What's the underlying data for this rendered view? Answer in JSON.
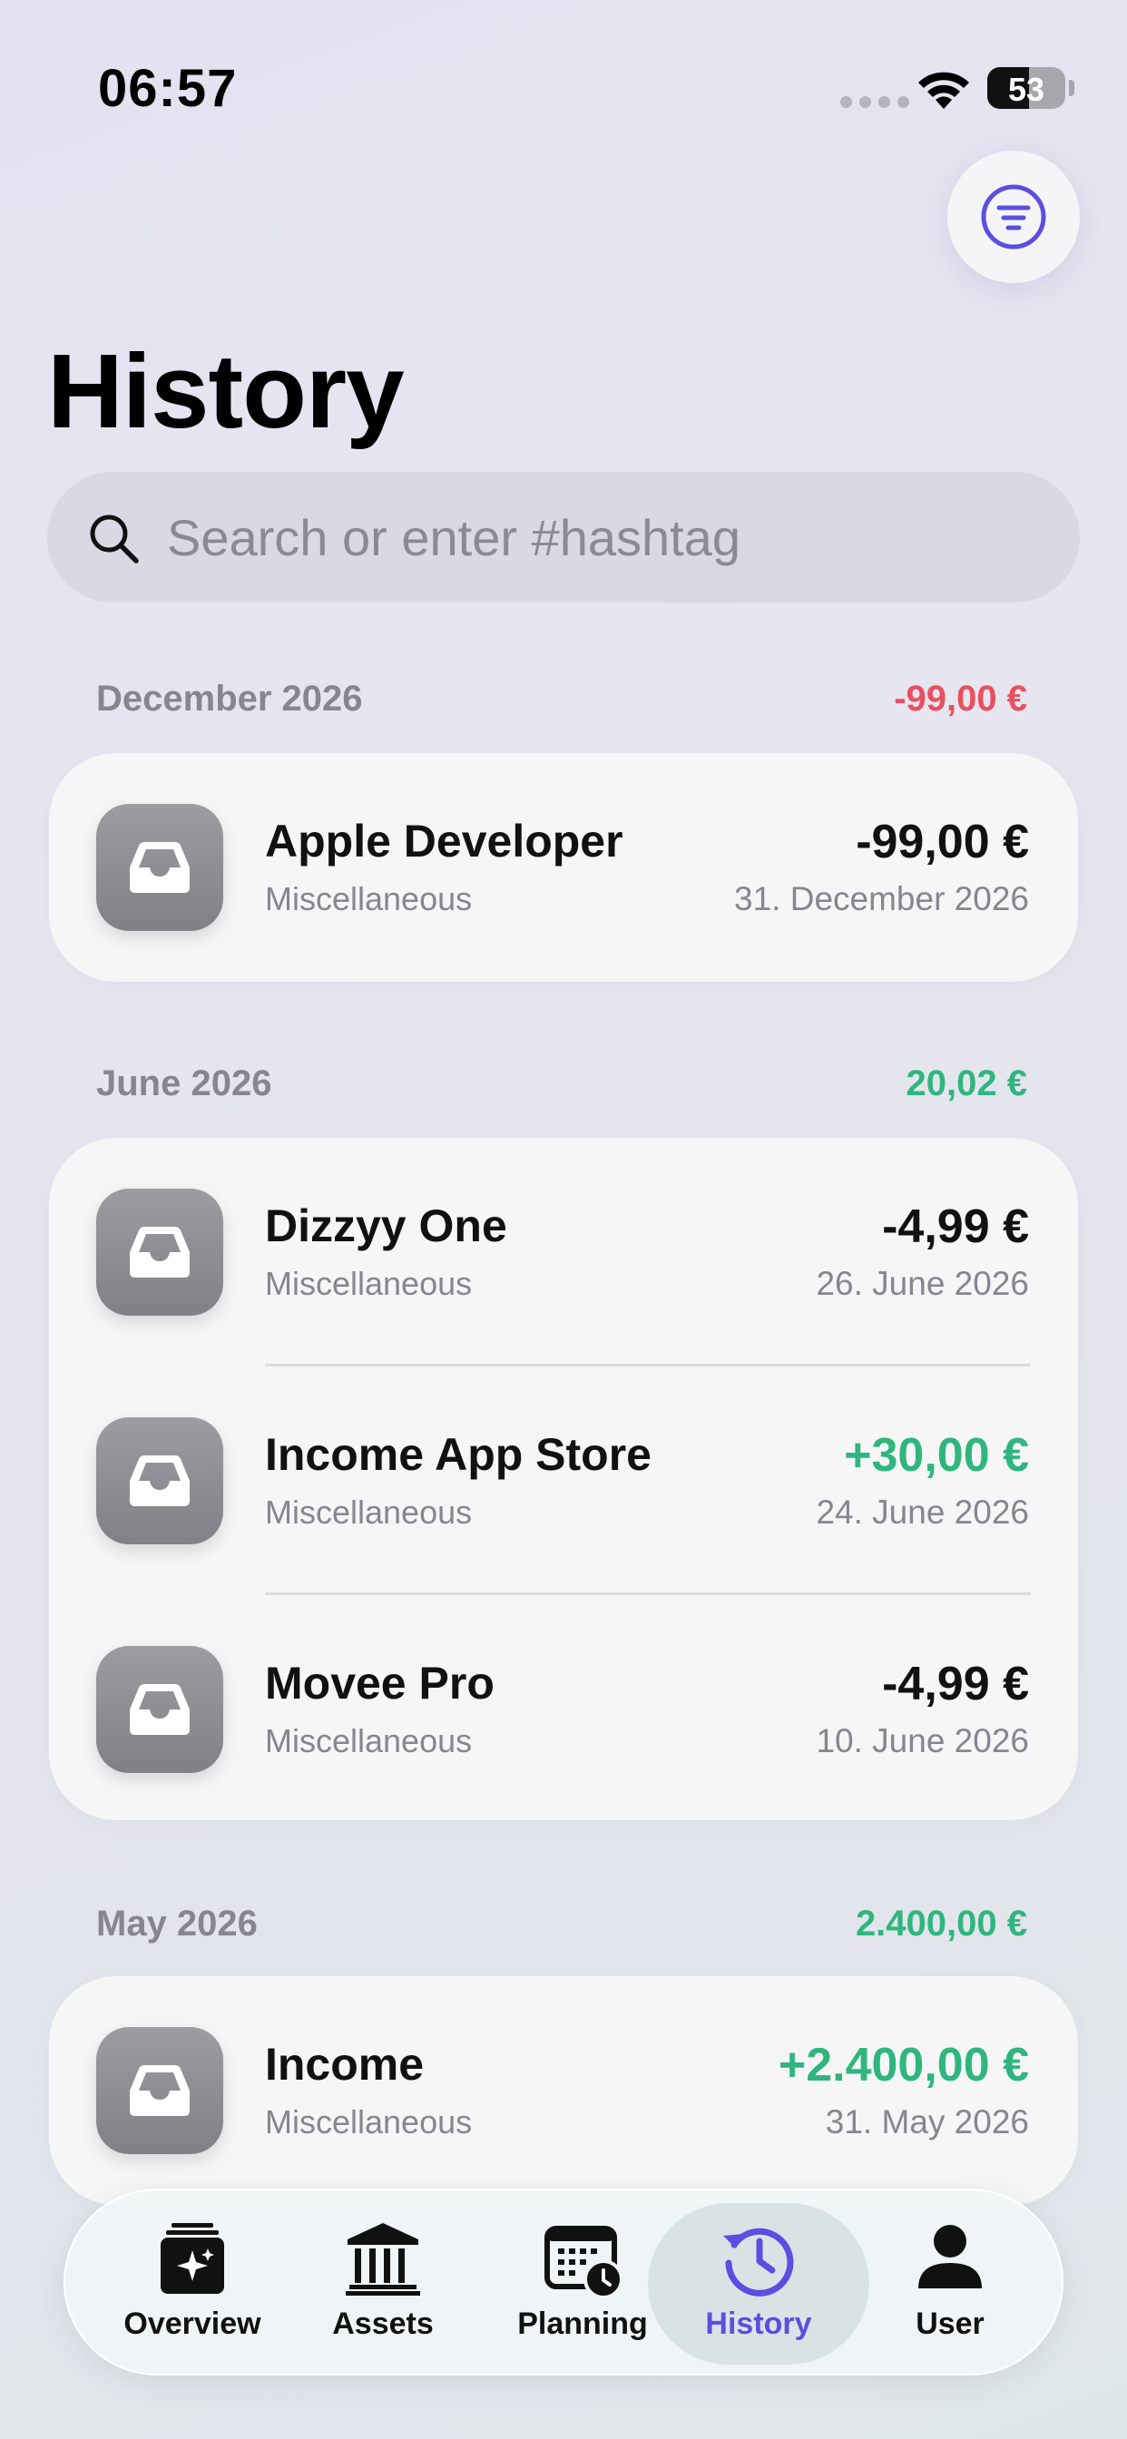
{
  "status_bar": {
    "time": "06:57",
    "battery": "53"
  },
  "page": {
    "title": "History"
  },
  "search": {
    "placeholder": "Search or enter #hashtag"
  },
  "sections": [
    {
      "month": "December 2026",
      "total": "-99,00 €",
      "items": [
        {
          "title": "Apple Developer",
          "category": "Miscellaneous",
          "amount": "-99,00 €",
          "date": "31. December 2026"
        }
      ]
    },
    {
      "month": "June 2026",
      "total": "20,02 €",
      "items": [
        {
          "title": "Dizzyy One",
          "category": "Miscellaneous",
          "amount": "-4,99 €",
          "date": "26. June 2026"
        },
        {
          "title": "Income App Store",
          "category": "Miscellaneous",
          "amount": "+30,00 €",
          "date": "24. June 2026"
        },
        {
          "title": "Movee Pro",
          "category": "Miscellaneous",
          "amount": "-4,99 €",
          "date": "10. June 2026"
        }
      ]
    },
    {
      "month": "May 2026",
      "total": "2.400,00 €",
      "items": [
        {
          "title": "Income",
          "category": "Miscellaneous",
          "amount": "+2.400,00 €",
          "date": "31. May 2026"
        }
      ]
    }
  ],
  "tab_bar": {
    "tabs": [
      {
        "label": "Overview",
        "icon": "overview-icon"
      },
      {
        "label": "Assets",
        "icon": "bank-icon"
      },
      {
        "label": "Planning",
        "icon": "calendar-clock-icon"
      },
      {
        "label": "History",
        "icon": "history-icon"
      },
      {
        "label": "User",
        "icon": "person-icon"
      }
    ],
    "active": "History"
  },
  "colors": {
    "accent": "#5b4ee0",
    "positive": "#2fb67e",
    "negative": "#e8505f"
  }
}
